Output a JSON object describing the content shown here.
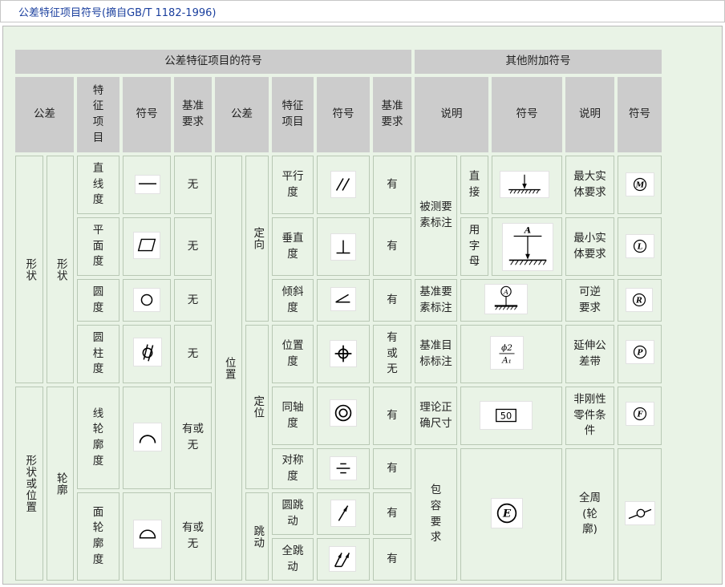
{
  "page": {
    "title": "公差特征项目符号(摘自GB/T 1182-1996)"
  },
  "header": {
    "left_group": "公差特征项目的符号",
    "right_group": "其他附加符号",
    "col_tolerance": "公差",
    "col_feature": "特征项目",
    "col_symbol": "符号",
    "col_datum": "基准要求",
    "col_desc": "说明"
  },
  "form": {
    "group": "形状",
    "sub": "形状",
    "rows": [
      {
        "feature": "直线度",
        "datum": "无",
        "icon": "straightness-icon"
      },
      {
        "feature": "平面度",
        "datum": "无",
        "icon": "flatness-icon"
      },
      {
        "feature": "圆度",
        "datum": "无",
        "icon": "roundness-icon"
      },
      {
        "feature": "圆柱度",
        "datum": "无",
        "icon": "cylindricity-icon"
      }
    ]
  },
  "profile": {
    "group": "形状或位置",
    "sub": "轮廓",
    "rows": [
      {
        "feature": "线轮廓度",
        "datum": "有或无",
        "icon": "line-profile-icon"
      },
      {
        "feature": "面轮廓度",
        "datum": "有或无",
        "icon": "surface-profile-icon"
      }
    ]
  },
  "position": {
    "group": "位置",
    "orientation": {
      "label": "定向",
      "rows": [
        {
          "feature": "平行度",
          "datum": "有",
          "icon": "parallelism-icon"
        },
        {
          "feature": "垂直度",
          "datum": "有",
          "icon": "perpendicularity-icon"
        },
        {
          "feature": "倾斜度",
          "datum": "有",
          "icon": "angularity-icon"
        }
      ]
    },
    "location": {
      "label": "定位",
      "rows": [
        {
          "feature": "位置度",
          "datum": "有或无",
          "icon": "position-icon"
        },
        {
          "feature": "同轴度",
          "datum": "有",
          "icon": "concentricity-icon"
        },
        {
          "feature": "对称度",
          "datum": "有",
          "icon": "symmetry-icon"
        }
      ]
    },
    "runout": {
      "label": "跳动",
      "rows": [
        {
          "feature": "圆跳动",
          "datum": "有",
          "icon": "circular-runout-icon"
        },
        {
          "feature": "全跳动",
          "datum": "有",
          "icon": "total-runout-icon"
        }
      ]
    }
  },
  "extra": {
    "measured": {
      "label": "被测要素标注",
      "direct": "直接",
      "letter": "用字母",
      "letter_symbol": "A"
    },
    "datum_feature": {
      "label": "基准要素标注",
      "symbol_text": "A"
    },
    "datum_target": {
      "label": "基准目标标注",
      "top": "ϕ2",
      "bottom": "A₁"
    },
    "theoretical": {
      "label": "理论正确尺寸",
      "value": "50"
    },
    "envelope": {
      "label": "包容要求",
      "letter": "E"
    },
    "right": [
      {
        "desc": "最大实体要求",
        "letter": "M"
      },
      {
        "desc": "最小实体要求",
        "letter": "L"
      },
      {
        "desc": "可逆要求",
        "letter": "R"
      },
      {
        "desc": "延伸公差带",
        "letter": "P"
      },
      {
        "desc": "非刚性零件条件",
        "letter": "F"
      },
      {
        "desc": "全周(轮廓)",
        "letter": ""
      }
    ]
  }
}
